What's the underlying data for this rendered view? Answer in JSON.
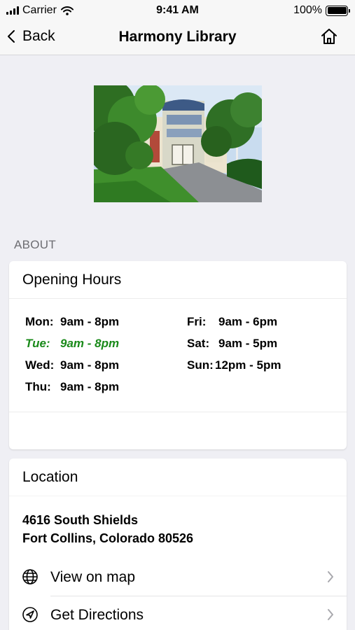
{
  "status_bar": {
    "carrier": "Carrier",
    "time": "9:41 AM",
    "battery": "100%",
    "battery_level": 1.0
  },
  "nav": {
    "back_label": "Back",
    "title": "Harmony Library",
    "home_icon": "home-icon"
  },
  "hero_image": {
    "subject": "library-building-photo"
  },
  "section_label": "ABOUT",
  "hours_card": {
    "title": "Opening Hours",
    "left": [
      {
        "day": "Mon:",
        "hours": "9am - 8pm",
        "today": false
      },
      {
        "day": "Tue:",
        "hours": "9am - 8pm",
        "today": true
      },
      {
        "day": "Wed:",
        "hours": "9am - 8pm",
        "today": false
      },
      {
        "day": "Thu:",
        "hours": "9am - 8pm",
        "today": false
      }
    ],
    "right": [
      {
        "day": "Fri:",
        "hours": "9am - 6pm"
      },
      {
        "day": "Sat:",
        "hours": "9am - 5pm"
      },
      {
        "day": "Sun:",
        "hours": "12pm - 5pm"
      }
    ],
    "today_color": "#1a8a1a"
  },
  "location_card": {
    "title": "Location",
    "address_line1": "4616 South Shields",
    "address_line2": "Fort Collins, Colorado 80526",
    "actions": [
      {
        "label": "View on map",
        "icon": "globe-icon"
      },
      {
        "label": "Get Directions",
        "icon": "navigation-arrow-icon"
      }
    ]
  }
}
